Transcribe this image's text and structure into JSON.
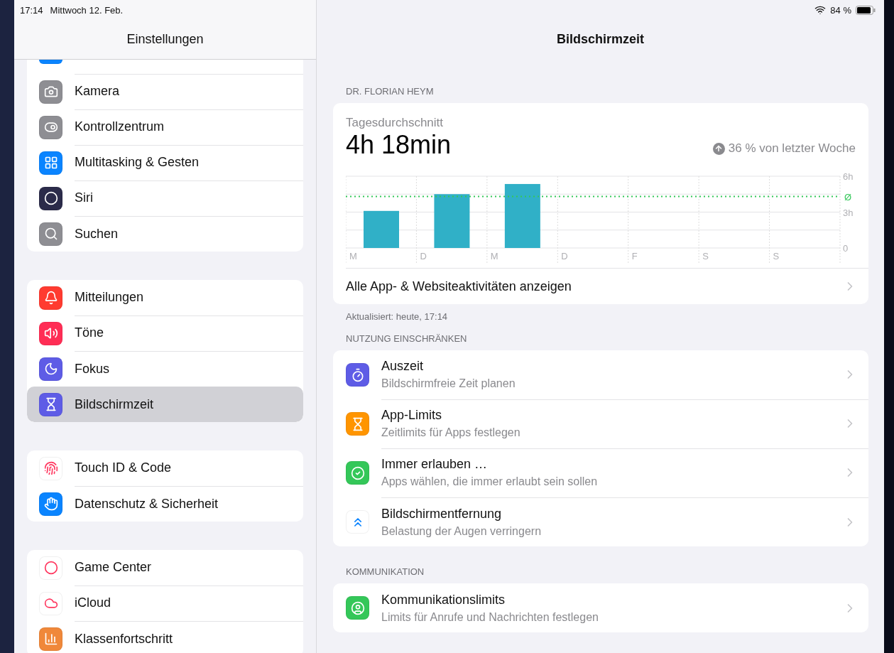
{
  "status_bar": {
    "time": "17:14",
    "date": "Mittwoch 12. Feb.",
    "battery": "84 %"
  },
  "sidebar": {
    "title": "Einstellungen",
    "groups": [
      {
        "items": [
          {
            "label": "Kamera",
            "color": "#8e8e93",
            "selected": false
          },
          {
            "label": "Kontrollzentrum",
            "color": "#8e8e93",
            "selected": false
          },
          {
            "label": "Multitasking & Gesten",
            "color": "#0a84ff",
            "selected": false
          },
          {
            "label": "Siri",
            "color": "#2b2b4a",
            "selected": false
          },
          {
            "label": "Suchen",
            "color": "#8e8e93",
            "selected": false
          }
        ]
      },
      {
        "items": [
          {
            "label": "Mitteilungen",
            "color": "#ff3b30",
            "selected": false
          },
          {
            "label": "Töne",
            "color": "#ff2d55",
            "selected": false
          },
          {
            "label": "Fokus",
            "color": "#5e5ce6",
            "selected": false
          },
          {
            "label": "Bildschirmzeit",
            "color": "#5e5ce6",
            "selected": true
          }
        ]
      },
      {
        "items": [
          {
            "label": "Touch ID & Code",
            "color": "#ffffff",
            "selected": false
          },
          {
            "label": "Datenschutz & Sicherheit",
            "color": "#0a84ff",
            "selected": false
          }
        ]
      },
      {
        "items": [
          {
            "label": "Game Center",
            "color": "#ffffff",
            "selected": false
          },
          {
            "label": "iCloud",
            "color": "#ffffff",
            "selected": false
          },
          {
            "label": "Klassenfortschritt",
            "color": "#f0883a",
            "selected": false
          }
        ]
      }
    ]
  },
  "detail": {
    "title": "Bildschirmzeit",
    "user_header": "DR. FLORIAN HEYM",
    "summary": {
      "label": "Tagesdurchschnitt",
      "value": "4h 18min",
      "change": "36 % von letzter Woche",
      "chart_data": {
        "type": "bar",
        "categories": [
          "M",
          "D",
          "M",
          "D",
          "F",
          "S",
          "S"
        ],
        "values": [
          3.1,
          4.5,
          5.35,
          null,
          null,
          null,
          null
        ],
        "ylim": [
          0,
          6
        ],
        "yticks": [
          {
            "value": 0,
            "label": "0"
          },
          {
            "value": 3,
            "label": "3h"
          },
          {
            "value": 6,
            "label": "6h"
          }
        ],
        "ref_lines": [
          {
            "axis": "y",
            "value": 4.3,
            "label": "Ø",
            "color": "#34c759"
          }
        ]
      },
      "link": "Alle App- & Websiteaktivitäten anzeigen"
    },
    "updated": "Aktualisiert: heute, 17:14",
    "sections": [
      {
        "header": "NUTZUNG EINSCHRÄNKEN",
        "rows": [
          {
            "title": "Auszeit",
            "subtitle": "Bildschirmfreie Zeit planen",
            "color": "#5e5ce6"
          },
          {
            "title": "App-Limits",
            "subtitle": "Zeitlimits für Apps festlegen",
            "color": "#ff9500"
          },
          {
            "title": "Immer erlauben …",
            "subtitle": "Apps wählen, die immer erlaubt sein sollen",
            "color": "#34c759"
          },
          {
            "title": "Bildschirmentfernung",
            "subtitle": "Belastung der Augen verringern",
            "color": "#ffffff"
          }
        ]
      },
      {
        "header": "KOMMUNIKATION",
        "rows": [
          {
            "title": "Kommunikationslimits",
            "subtitle": "Limits für Anrufe und Nachrichten festlegen",
            "color": "#34c759"
          }
        ]
      }
    ]
  }
}
